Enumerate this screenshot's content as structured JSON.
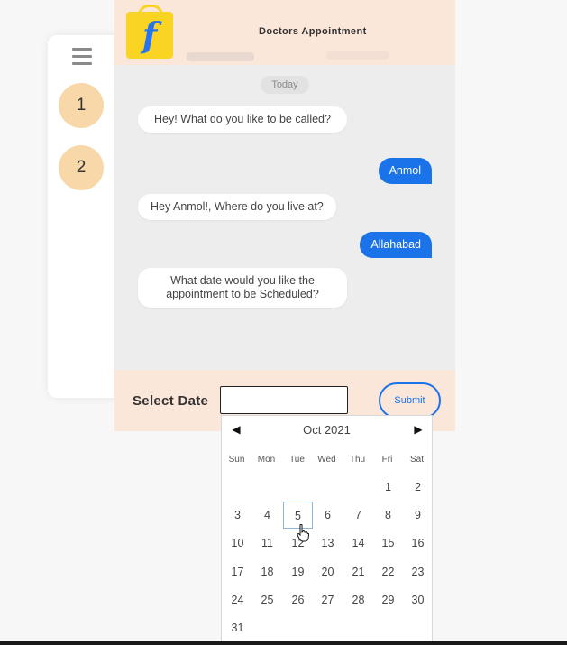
{
  "stepper": {
    "steps": [
      "1",
      "2"
    ]
  },
  "chat": {
    "title": "Doctors Appointment",
    "logo_glyph": "f",
    "day_chip": "Today",
    "messages": [
      {
        "from": "bot",
        "text": "Hey! What do you like to be called?"
      },
      {
        "from": "user",
        "text": "Anmol"
      },
      {
        "from": "bot",
        "text": "Hey Anmol!, Where do you live at?"
      },
      {
        "from": "user",
        "text": "Allahabad"
      },
      {
        "from": "bot",
        "text": "What date would you like the appointment to be Scheduled?"
      }
    ]
  },
  "input_bar": {
    "label": "Select Date",
    "date_value": "",
    "submit_label": "Submit"
  },
  "calendar": {
    "prev_icon": "◀",
    "next_icon": "▶",
    "month_label": "Oct 2021",
    "weekdays": [
      "Sun",
      "Mon",
      "Tue",
      "Wed",
      "Thu",
      "Fri",
      "Sat"
    ],
    "first_weekday_index": 5,
    "days_in_month": 31,
    "selected_day": 5
  },
  "colors": {
    "accent": "#1a73e8",
    "header_bg": "#fbe6da",
    "step_bg": "#f8d8a8",
    "logo_bg": "#f9d423"
  }
}
